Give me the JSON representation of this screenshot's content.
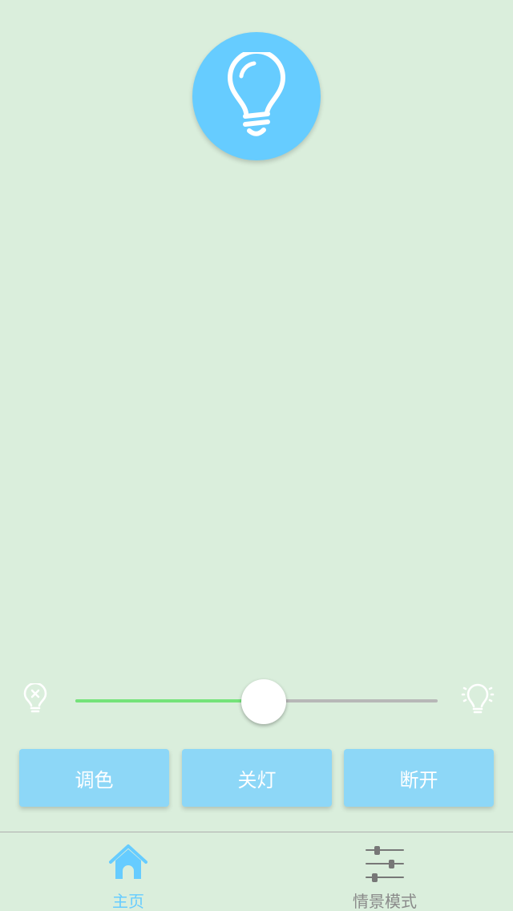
{
  "app": {
    "accent_color": "#66CCFF",
    "background_color": "#DAEEDC"
  },
  "power_toggle": {
    "icon": "lightbulb-icon",
    "color": "#66CCFF"
  },
  "brightness": {
    "level": 0.52,
    "min_icon": "bulb-off-icon",
    "max_icon": "bulb-bright-icon",
    "fill_color": "#74E37A"
  },
  "actions": {
    "color_label": "调色",
    "off_label": "关灯",
    "disconnect_label": "断开"
  },
  "tabs": {
    "home_label": "主页",
    "home_icon": "home-icon",
    "scene_label": "情景模式",
    "scene_icon": "sliders-icon",
    "active": "home"
  }
}
